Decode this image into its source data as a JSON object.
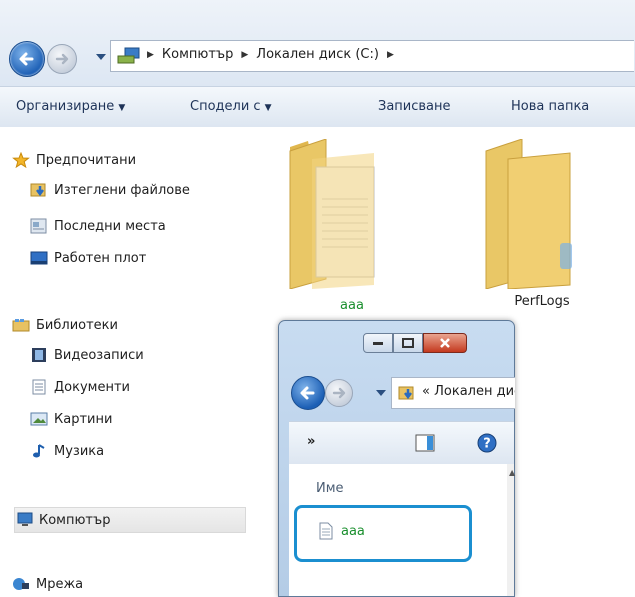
{
  "address": {
    "breadcrumbs": [
      "Компютър",
      "Локален диск (C:)"
    ]
  },
  "toolbar": {
    "organize": "Организиране",
    "share": "Сподели с",
    "burn": "Записване",
    "new_folder": "Нова папка"
  },
  "navigation": {
    "favorites": "Предпочитани",
    "downloads": "Изтеглени файлове",
    "recent": "Последни места",
    "desktop": "Работен плот",
    "libraries": "Библиотеки",
    "videos": "Видеозаписи",
    "documents": "Документи",
    "pictures": "Картини",
    "music": "Музика",
    "computer": "Компютър",
    "network": "Мрежа"
  },
  "content": {
    "items": [
      {
        "name": "aaa",
        "color": "#1a8f2e"
      },
      {
        "name": "PerfLogs",
        "color": "#1e1e1e"
      }
    ]
  },
  "dialog": {
    "address_prefix": "«",
    "address_text": "Локален диск (C:)",
    "overflow": "»",
    "column_name": "Име",
    "file_name": "aaa"
  },
  "colors": {
    "accent_highlight": "#1b8fd0",
    "new_item_text": "#1a8f2e"
  }
}
